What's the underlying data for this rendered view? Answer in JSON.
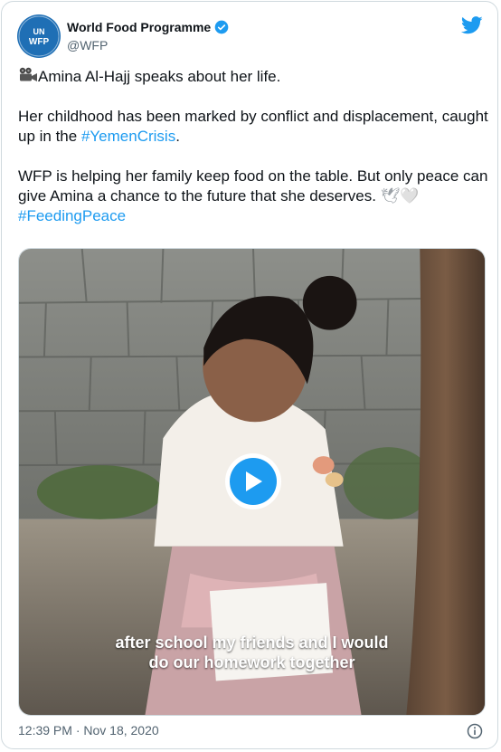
{
  "account": {
    "name": "World Food Programme",
    "handle": "@WFP",
    "avatar_text_top": "UN",
    "avatar_text_bottom": "WFP",
    "verified": true
  },
  "tweet": {
    "line1": "Amina Al-Hajj speaks about her life.",
    "line1_icon": "movie-camera-icon",
    "para2_text": "Her childhood has been marked by conflict and displacement, caught up in the ",
    "para2_hashtag": "#YemenCrisis",
    "para2_end": ".",
    "para3_text": "WFP is helping her family keep food on the table. But only peace can give Amina a chance to the future that she deserves. ",
    "para3_emoji": "🕊🤍",
    "para3_hashtag": "#FeedingPeace"
  },
  "video": {
    "caption_line1": "after school my friends and I would",
    "caption_line2": "do our homework together"
  },
  "footer": {
    "timestamp": "12:39 PM · Nov 18, 2020"
  },
  "colors": {
    "accent": "#1d9bf0",
    "avatar_bg": "#1f6fb5",
    "secondary_text": "#536471"
  }
}
